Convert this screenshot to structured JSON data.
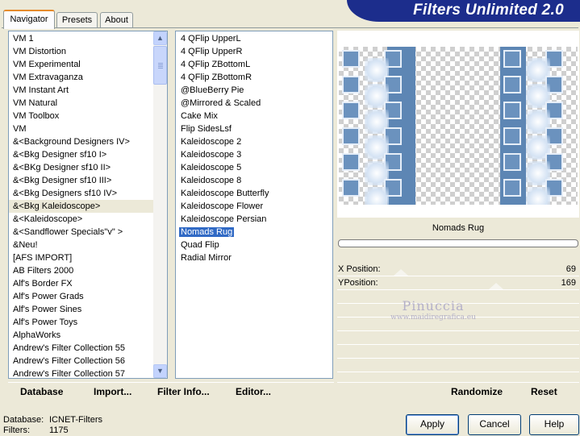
{
  "tabs": [
    {
      "label": "Navigator",
      "active": true
    },
    {
      "label": "Presets",
      "active": false
    },
    {
      "label": "About",
      "active": false
    }
  ],
  "app_title": "Filters Unlimited 2.0",
  "categories": {
    "items": [
      "VM 1",
      "VM Distortion",
      "VM Experimental",
      "VM Extravaganza",
      "VM Instant Art",
      "VM Natural",
      "VM Toolbox",
      "VM",
      "&<Background Designers IV>",
      "&<Bkg Designer sf10 I>",
      "&<BKg Designer sf10 II>",
      "&<Bkg Designer sf10 III>",
      "&<Bkg Designers sf10 IV>",
      "&<Bkg Kaleidoscope>",
      "&<Kaleidoscope>",
      "&<Sandflower Specials\"v\" >",
      "&Neu!",
      "[AFS IMPORT]",
      "AB Filters 2000",
      "Alf's Border FX",
      "Alf's Power Grads",
      "Alf's Power Sines",
      "Alf's Power Toys",
      "AlphaWorks",
      "Andrew's Filter Collection 55",
      "Andrew's Filter Collection 56",
      "Andrew's Filter Collection 57"
    ],
    "selected_index": 13
  },
  "filters": {
    "items": [
      "4 QFlip UpperL",
      "4 QFlip UpperR",
      "4 QFlip ZBottomL",
      "4 QFlip ZBottomR",
      "@BlueBerry Pie",
      "@Mirrored & Scaled",
      "Cake Mix",
      "Flip SidesLsf",
      "Kaleidoscope 2",
      "Kaleidoscope 3",
      "Kaleidoscope 5",
      "Kaleidoscope 8",
      "Kaleidoscope Butterfly",
      "Kaleidoscope Flower",
      "Kaleidoscope Persian",
      "Nomads Rug",
      "Quad Flip",
      "Radial Mirror"
    ],
    "selected_index": 15
  },
  "preview": {
    "filter_name": "Nomads Rug"
  },
  "params": [
    {
      "label": "X Position:",
      "value": "69"
    },
    {
      "label": "YPosition:",
      "value": "169"
    }
  ],
  "watermark": {
    "name": "Pinuccia",
    "site": "www.maidiregrafica.eu"
  },
  "left_buttons": {
    "database": "Database",
    "import": "Import...",
    "filter_info": "Filter Info...",
    "editor": "Editor..."
  },
  "right_buttons": {
    "randomize": "Randomize",
    "reset": "Reset"
  },
  "status": {
    "database_label": "Database:",
    "database_value": "ICNET-Filters",
    "filters_label": "Filters:",
    "filters_value": "1175"
  },
  "dialog_buttons": {
    "apply": "Apply",
    "cancel": "Cancel",
    "help": "Help"
  },
  "colors": {
    "banner": "#1c2d8c",
    "selection": "#316ac5",
    "rug_blue": "#5d86b4",
    "tab_accent": "#e68b2c"
  }
}
